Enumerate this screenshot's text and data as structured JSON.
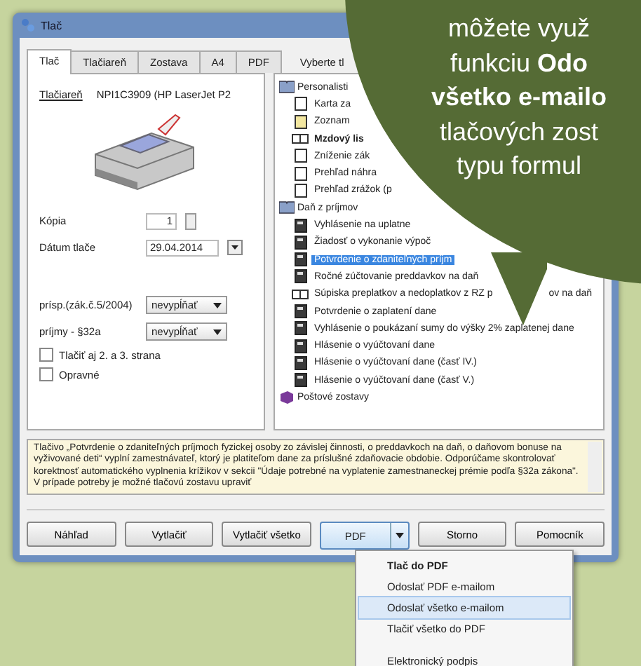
{
  "window": {
    "title": "Tlač"
  },
  "tabs": [
    {
      "label": "Tlač",
      "selected": true
    },
    {
      "label": "Tlačiareň",
      "selected": false
    },
    {
      "label": "Zostava",
      "selected": false
    },
    {
      "label": "A4",
      "selected": false
    },
    {
      "label": "PDF",
      "selected": false
    }
  ],
  "tree_header": "Vyberte tl",
  "printer": {
    "label": "Tlačiareň",
    "value": "NPI1C3909 (HP LaserJet P2"
  },
  "copies": {
    "label": "Kópia",
    "value": "1"
  },
  "print_date": {
    "label": "Dátum tlače",
    "value": "29.04.2014"
  },
  "selects": [
    {
      "label": "prísp.(zák.č.5/2004)",
      "value": "nevypĺňať"
    },
    {
      "label": "príjmy - §32a",
      "value": "nevypĺňať"
    }
  ],
  "checkboxes": [
    {
      "label": "Tlačiť aj 2. a 3. strana",
      "checked": false
    },
    {
      "label": "Opravné",
      "checked": false
    }
  ],
  "tree": [
    {
      "label": "Personalisti",
      "kind": "book",
      "children": [
        {
          "label": "Karta za",
          "kind": "page",
          "selected": false
        },
        {
          "label": "Zoznam",
          "kind": "note",
          "selected": false
        },
        {
          "label": "Mzdový lis",
          "kind": "ledger",
          "selected": false
        },
        {
          "label": "Zníženie zák",
          "kind": "page",
          "selected": false
        },
        {
          "label": "Prehľad náhra",
          "kind": "page",
          "selected": false
        },
        {
          "label": "Prehľad zrážok (p",
          "kind": "page",
          "selected": false
        }
      ]
    },
    {
      "label": "Daň z príjmov",
      "kind": "book",
      "children": [
        {
          "label": "Vyhlásenie na uplatne",
          "kind": "form",
          "selected": false
        },
        {
          "label": "Žiadosť o vykonanie výpoč",
          "kind": "form",
          "selected": false
        },
        {
          "label": "Potvrdenie o zdaniteľných príjm",
          "kind": "form",
          "selected": true
        },
        {
          "label": "Ročné zúčtovanie preddavkov na daň",
          "kind": "form",
          "selected": false
        },
        {
          "label": "Súpiska preplatkov a nedoplatkov z RZ p",
          "label_rest": "ov na daň",
          "kind": "open",
          "selected": false
        },
        {
          "label": "Potvrdenie o zaplatení dane",
          "kind": "form",
          "selected": false
        },
        {
          "label": "Vyhlásenie o poukázaní sumy do výšky 2% zaplatenej dane",
          "kind": "form",
          "selected": false
        },
        {
          "label": "Hlásenie o vyúčtovaní dane",
          "kind": "form",
          "selected": false
        },
        {
          "label": "Hlásenie o vyúčtovaní dane (časť IV.)",
          "kind": "form",
          "selected": false
        },
        {
          "label": "Hlásenie o vyúčtovaní dane (časť V.)",
          "kind": "form",
          "selected": false
        }
      ]
    },
    {
      "label": "Poštové zostavy",
      "kind": "postal"
    }
  ],
  "description": "Tlačivo „Potvrdenie o zdaniteľných príjmoch fyzickej osoby zo závislej činnosti, o preddavkoch na daň, o daňovom bonuse na vyživované deti“ vyplní zamestnávateľ, ktorý je platiteľom dane za príslušné zdaňovacie obdobie. Odporúčame skontrolovať korektnosť automatického vyplnenia krížikov v sekcii \"Údaje potrebné na vyplatenie zamestnaneckej prémie podľa §32a zákona\". V prípade potreby je možné tlačovú zostavu upraviť",
  "buttons": [
    {
      "label": "Náhľad",
      "kind": "plain"
    },
    {
      "label": "Vytlačiť",
      "kind": "plain"
    },
    {
      "label": "Vytlačiť všetko",
      "kind": "plain"
    },
    {
      "label": "PDF",
      "kind": "split"
    },
    {
      "label": "Storno",
      "kind": "plain"
    },
    {
      "label": "Pomocník",
      "kind": "plain"
    }
  ],
  "pdf_menu": [
    {
      "label": "Tlač do PDF",
      "kind": "default",
      "selected": false
    },
    {
      "label": "Odoslať PDF e-mailom",
      "kind": "item",
      "selected": false
    },
    {
      "label": "Odoslať všetko e-mailom",
      "kind": "item",
      "selected": true
    },
    {
      "label": "Tlačiť všetko do PDF",
      "kind": "item",
      "selected": false
    },
    {
      "label": "Elektronický podpis",
      "kind": "separated",
      "selected": false
    }
  ],
  "callout": {
    "lines": [
      "môžete využ",
      "funkciu **Odo**",
      "**všetko e-mailo**",
      "tlačových zost",
      "typu formul"
    ]
  }
}
